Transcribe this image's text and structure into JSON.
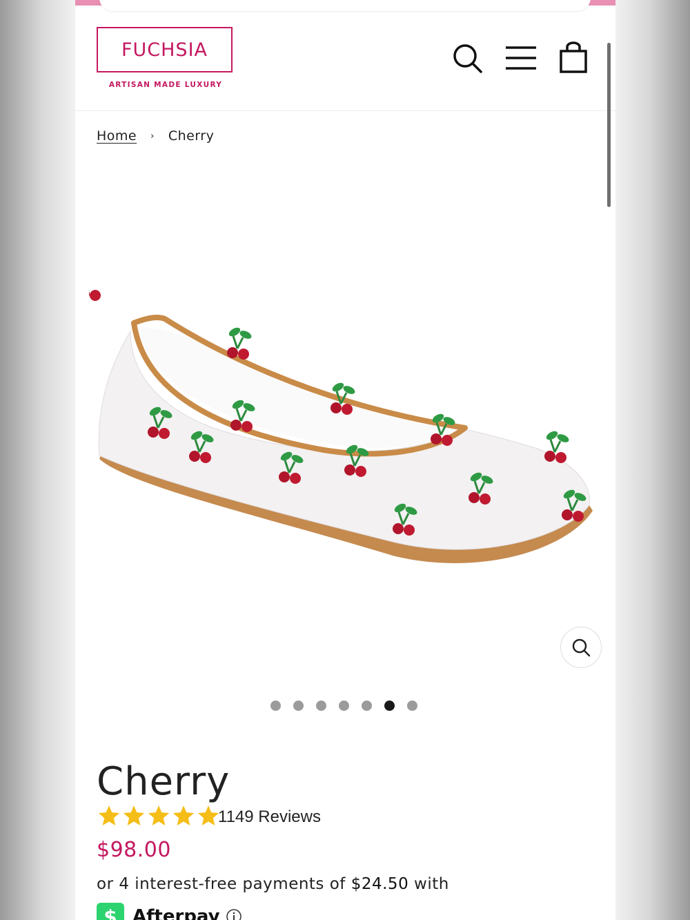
{
  "brand": {
    "name": "FUCHSIA",
    "tagline": "ARTISAN MADE LUXURY",
    "color": "#c4175f"
  },
  "header_icons": [
    "search-icon",
    "menu-icon",
    "cart-icon"
  ],
  "breadcrumb": {
    "home": "Home",
    "separator": "›",
    "current": "Cherry"
  },
  "gallery": {
    "image": "cherry-embroidered-mesh-flat",
    "dots_total": 7,
    "active_index": 5
  },
  "product": {
    "title": "Cherry",
    "rating": 5,
    "reviews": "1149 Reviews",
    "price": "$98.00"
  },
  "payment": {
    "prefix": "or 4 interest-free payments of ",
    "amount": "$24.50",
    "suffix": " with",
    "provider": "Afterpay",
    "provider_icon": "$"
  }
}
